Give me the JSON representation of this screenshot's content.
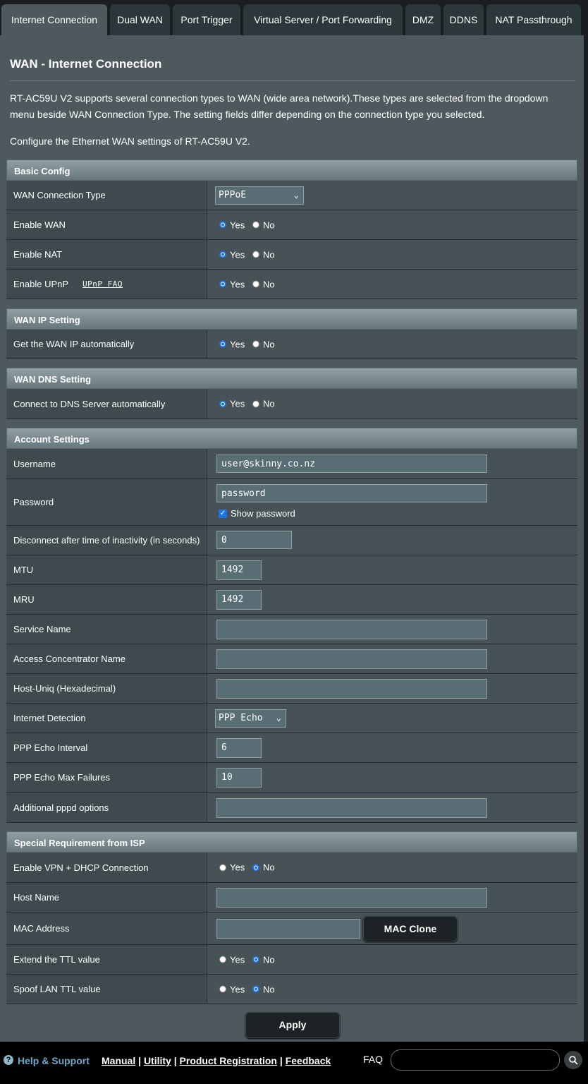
{
  "tabs": [
    {
      "label": "Internet Connection",
      "active": true
    },
    {
      "label": "Dual WAN"
    },
    {
      "label": "Port Trigger"
    },
    {
      "label": "Virtual Server / Port Forwarding"
    },
    {
      "label": "DMZ"
    },
    {
      "label": "DDNS"
    },
    {
      "label": "NAT Passthrough"
    }
  ],
  "page": {
    "title": "WAN - Internet Connection",
    "description": "RT-AC59U V2 supports several connection types to WAN (wide area network).These types are selected from the dropdown menu beside WAN Connection Type. The setting fields differ depending on the connection type you selected.",
    "configure_text": "Configure the Ethernet WAN settings of RT-AC59U V2."
  },
  "radio": {
    "yes": "Yes",
    "no": "No"
  },
  "basic": {
    "header": "Basic Config",
    "wan_type_label": "WAN Connection Type",
    "wan_type_value": "PPPoE",
    "enable_wan_label": "Enable WAN",
    "enable_nat_label": "Enable NAT",
    "enable_upnp_label": "Enable UPnP",
    "upnp_faq": "UPnP FAQ"
  },
  "wan_ip": {
    "header": "WAN IP Setting",
    "auto_label": "Get the WAN IP automatically"
  },
  "wan_dns": {
    "header": "WAN DNS Setting",
    "auto_label": "Connect to DNS Server automatically"
  },
  "account": {
    "header": "Account Settings",
    "username_label": "Username",
    "username_value": "user@skinny.co.nz",
    "password_label": "Password",
    "password_value": "password",
    "show_password": "Show password",
    "idle_label": "Disconnect after time of inactivity (in seconds)",
    "idle_value": "0",
    "mtu_label": "MTU",
    "mtu_value": "1492",
    "mru_label": "MRU",
    "mru_value": "1492",
    "service_label": "Service Name",
    "service_value": "",
    "ac_label": "Access Concentrator Name",
    "ac_value": "",
    "hostuniq_label": "Host-Uniq (Hexadecimal)",
    "hostuniq_value": "",
    "detect_label": "Internet Detection",
    "detect_value": "PPP Echo",
    "echo_interval_label": "PPP Echo Interval",
    "echo_interval_value": "6",
    "echo_max_label": "PPP Echo Max Failures",
    "echo_max_value": "10",
    "pppd_label": "Additional pppd options",
    "pppd_value": ""
  },
  "isp": {
    "header": "Special Requirement from ISP",
    "vpn_label": "Enable VPN + DHCP Connection",
    "host_label": "Host Name",
    "host_value": "",
    "mac_label": "MAC Address",
    "mac_value": "",
    "mac_clone": "MAC Clone",
    "ttl_label": "Extend the TTL value",
    "spoof_label": "Spoof LAN TTL value"
  },
  "apply": "Apply",
  "footer": {
    "help": "Help & Support",
    "manual": "Manual",
    "utility": "Utility",
    "registration": "Product Registration",
    "feedback": "Feedback",
    "sep": "|",
    "faq": "FAQ",
    "faq_placeholder": ""
  },
  "colors": {
    "accent": "#1a73e8",
    "panel": "#4d595d",
    "help": "#6fa8c9"
  }
}
